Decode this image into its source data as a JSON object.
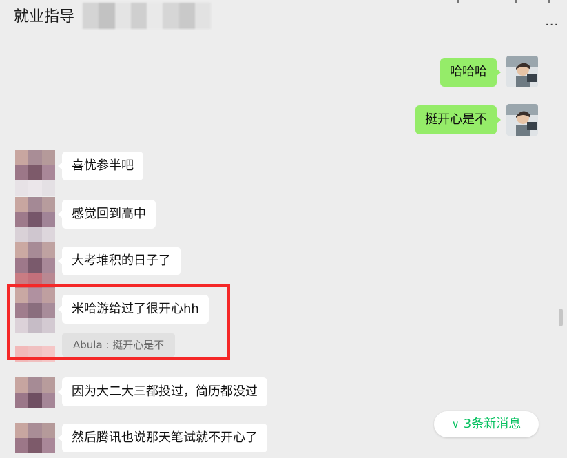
{
  "header": {
    "title": "就业指导",
    "more_label": "..."
  },
  "messages": [
    {
      "side": "self",
      "text": "哈哈哈"
    },
    {
      "side": "self",
      "text": "挺开心是不"
    },
    {
      "side": "other",
      "text": "喜忧参半吧"
    },
    {
      "side": "other",
      "text": "感觉回到高中"
    },
    {
      "side": "other",
      "text": "大考堆积的日子了"
    },
    {
      "side": "other",
      "text": "米哈游给过了很开心hh",
      "quote": "Abula : 挺开心是不"
    },
    {
      "side": "other",
      "text": "因为大二大三都投过，简历都没过"
    },
    {
      "side": "other",
      "text": "然后腾讯也说那天笔试就不开心了"
    }
  ],
  "new_messages_label": "3条新消息",
  "colors": {
    "self_bubble": "#95ec69",
    "other_bubble": "#ffffff",
    "highlight": "#f52828",
    "new_messages": "#07c160"
  },
  "icons": {
    "more": "more-icon",
    "new_messages": "chevron-double-down-icon"
  }
}
